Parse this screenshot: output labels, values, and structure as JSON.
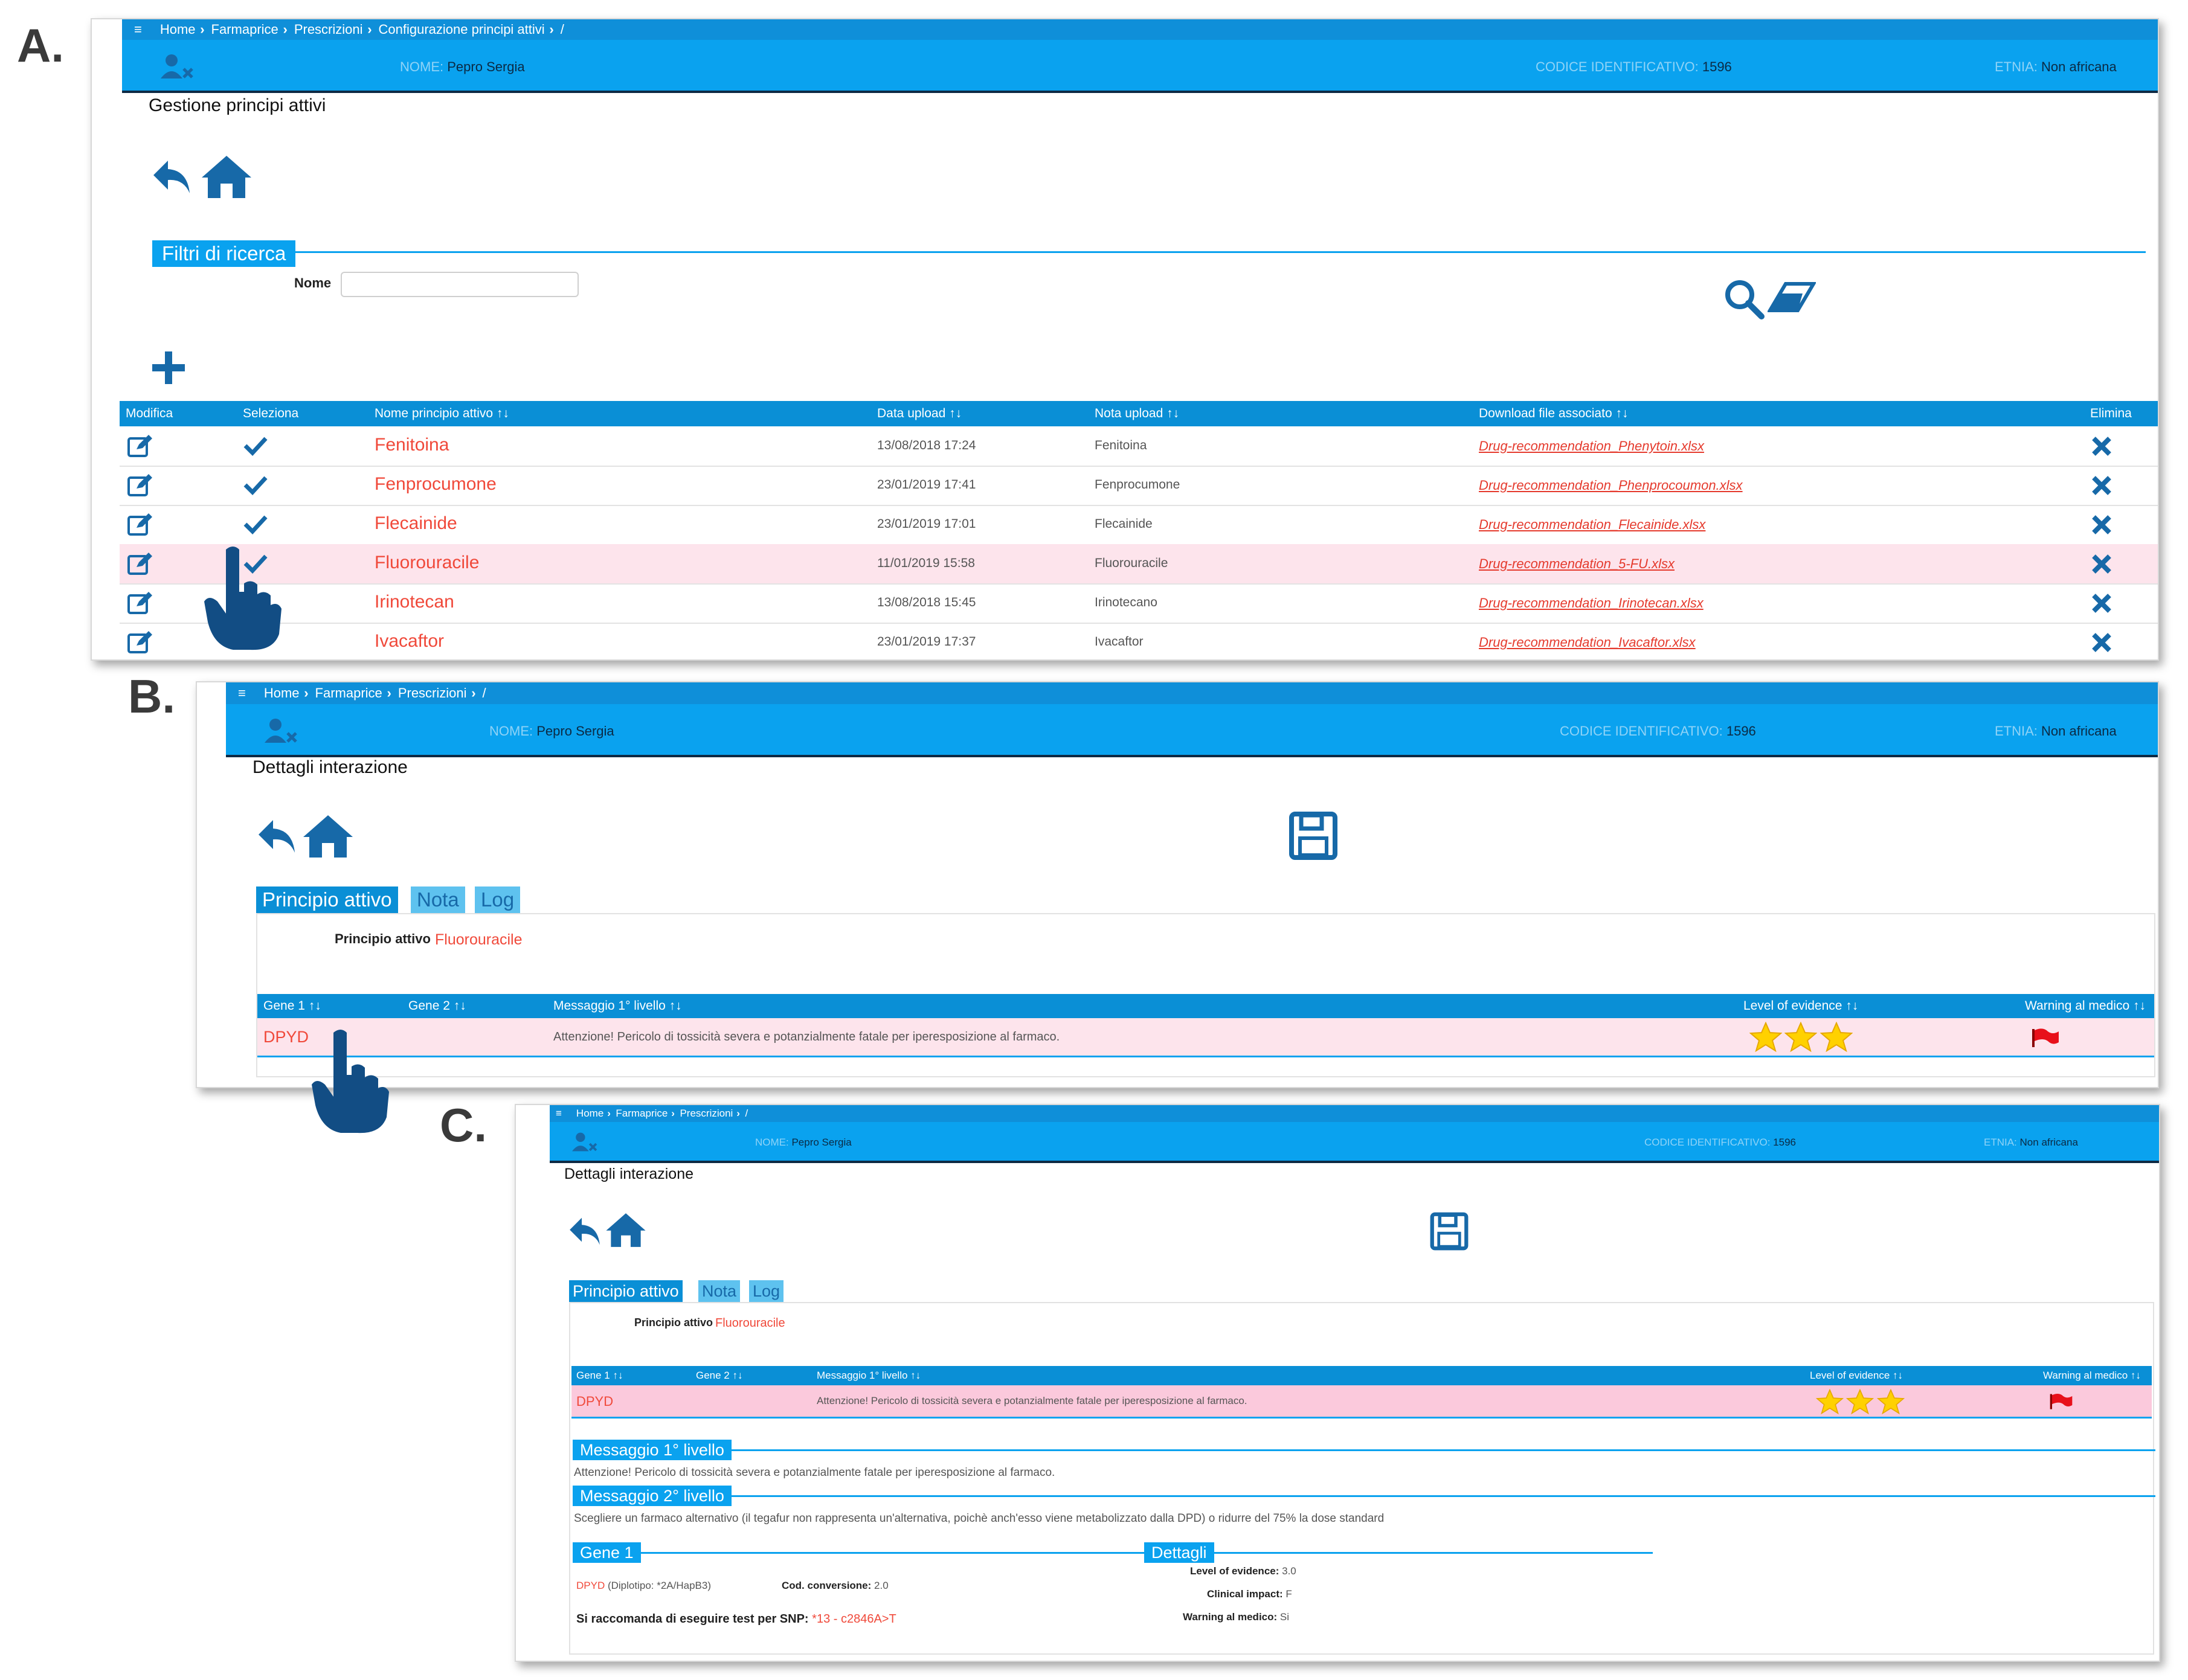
{
  "panel_letters": [
    "A.",
    "B.",
    "C."
  ],
  "colors": {
    "accent": "#0aa2ef",
    "header_dark": "#0e2a44",
    "highlight_row": "#fde4ec",
    "highlight_row_c": "#fbc9dc",
    "red_text": "#f0493a",
    "icon_blue": "#1769a8",
    "star": "#ffd100",
    "flag": "#e8101a"
  },
  "panel_a": {
    "breadcrumb": [
      "Home",
      "Farmaprice",
      "Prescrizioni",
      "Configurazione principi attivi",
      "/"
    ],
    "menu_icon": "≡",
    "patient": {
      "name_label": "NOME:",
      "name": "Pepro Sergia",
      "code_label": "CODICE IDENTIFICATIVO:",
      "code": "1596",
      "ethnicity_label": "ETNIA:",
      "ethnicity": "Non africana"
    },
    "title": "Gestione principi attivi",
    "filters_label": "Filtri di ricerca",
    "name_filter_label": "Nome",
    "name_filter_value": "",
    "table": {
      "headers": [
        "Modifica",
        "Seleziona",
        "Nome principio attivo ↑↓",
        "Data upload ↑↓",
        "Nota upload ↑↓",
        "Download file associato ↑↓",
        "Elimina"
      ],
      "rows": [
        {
          "name": "Fenitoina",
          "date": "13/08/2018 17:24",
          "note": "Fenitoina",
          "file": "Drug-recommendation_Phenytoin.xlsx",
          "selected": true
        },
        {
          "name": "Fenprocumone",
          "date": "23/01/2019 17:41",
          "note": "Fenprocumone",
          "file": "Drug-recommendation_Phenprocoumon.xlsx",
          "selected": true
        },
        {
          "name": "Flecainide",
          "date": "23/01/2019 17:01",
          "note": "Flecainide",
          "file": "Drug-recommendation_Flecainide.xlsx",
          "selected": true
        },
        {
          "name": "Fluorouracile",
          "date": "11/01/2019 15:58",
          "note": "Fluorouracile",
          "file": "Drug-recommendation_5-FU.xlsx",
          "selected": true
        },
        {
          "name": "Irinotecan",
          "date": "13/08/2018 15:45",
          "note": "Irinotecano",
          "file": "Drug-recommendation_Irinotecan.xlsx",
          "selected": false
        },
        {
          "name": "Ivacaftor",
          "date": "23/01/2019 17:37",
          "note": "Ivacaftor",
          "file": "Drug-recommendation_Ivacaftor.xlsx",
          "selected": false
        }
      ]
    }
  },
  "panel_b": {
    "breadcrumb": [
      "Home",
      "Farmaprice",
      "Prescrizioni",
      "/"
    ],
    "menu_icon": "≡",
    "patient": {
      "name_label": "NOME:",
      "name": "Pepro Sergia",
      "code_label": "CODICE IDENTIFICATIVO:",
      "code": "1596",
      "ethnicity_label": "ETNIA:",
      "ethnicity": "Non africana"
    },
    "title": "Dettagli interazione",
    "tabs": [
      "Principio attivo",
      "Nota",
      "Log"
    ],
    "active_ingredient_label": "Principio attivo",
    "active_ingredient": "Fluorouracile",
    "table": {
      "headers": [
        "Gene 1 ↑↓",
        "Gene 2 ↑↓",
        "Messaggio 1° livello ↑↓",
        "Level of evidence ↑↓",
        "Warning al medico ↑↓"
      ],
      "row": {
        "gene1": "DPYD",
        "gene2": "",
        "message": "Attenzione! Pericolo di tossicità severa e potanzialmente fatale per iperesposizione al farmaco.",
        "stars": 3
      }
    }
  },
  "panel_c": {
    "breadcrumb": [
      "Home",
      "Farmaprice",
      "Prescrizioni",
      "/"
    ],
    "menu_icon": "≡",
    "patient": {
      "name_label": "NOME:",
      "name": "Pepro Sergia",
      "code_label": "CODICE IDENTIFICATIVO:",
      "code": "1596",
      "ethnicity_label": "ETNIA:",
      "ethnicity": "Non africana"
    },
    "title": "Dettagli interazione",
    "tabs": [
      "Principio attivo",
      "Nota",
      "Log"
    ],
    "active_ingredient_label": "Principio attivo",
    "active_ingredient": "Fluorouracile",
    "table": {
      "headers": [
        "Gene 1 ↑↓",
        "Gene 2 ↑↓",
        "Messaggio 1° livello ↑↓",
        "Level of evidence ↑↓",
        "Warning al medico ↑↓"
      ],
      "row": {
        "gene1": "DPYD",
        "message": "Attenzione! Pericolo di tossicità severa e potanzialmente fatale per iperesposizione al farmaco.",
        "stars": 3
      }
    },
    "msg1_label": "Messaggio 1° livello",
    "msg1": "Attenzione! Pericolo di tossicità severa e potanzialmente fatale per iperesposizione al farmaco.",
    "msg2_label": "Messaggio 2° livello",
    "msg2": "Scegliere un farmaco alternativo (il tegafur non rappresenta un'alternativa, poichè anch'esso viene metabolizzato dalla DPD) o ridurre del 75% la dose standard",
    "gene1_label": "Gene 1",
    "gene1_name": "DPYD",
    "gene1_diplotype": "(Diplotipo: *2A/HapB3)",
    "conversion_label": "Cod. conversione:",
    "conversion_value": "2.0",
    "snp_label": "Si raccomanda di eseguire test per SNP:",
    "snp_value": "*13 - c2846A>T",
    "details_label": "Dettagli",
    "evidence_label": "Level of evidence:",
    "evidence_value": "3.0",
    "clinical_label": "Clinical impact:",
    "clinical_value": "F",
    "warning_label": "Warning al medico:",
    "warning_value": "Si"
  }
}
